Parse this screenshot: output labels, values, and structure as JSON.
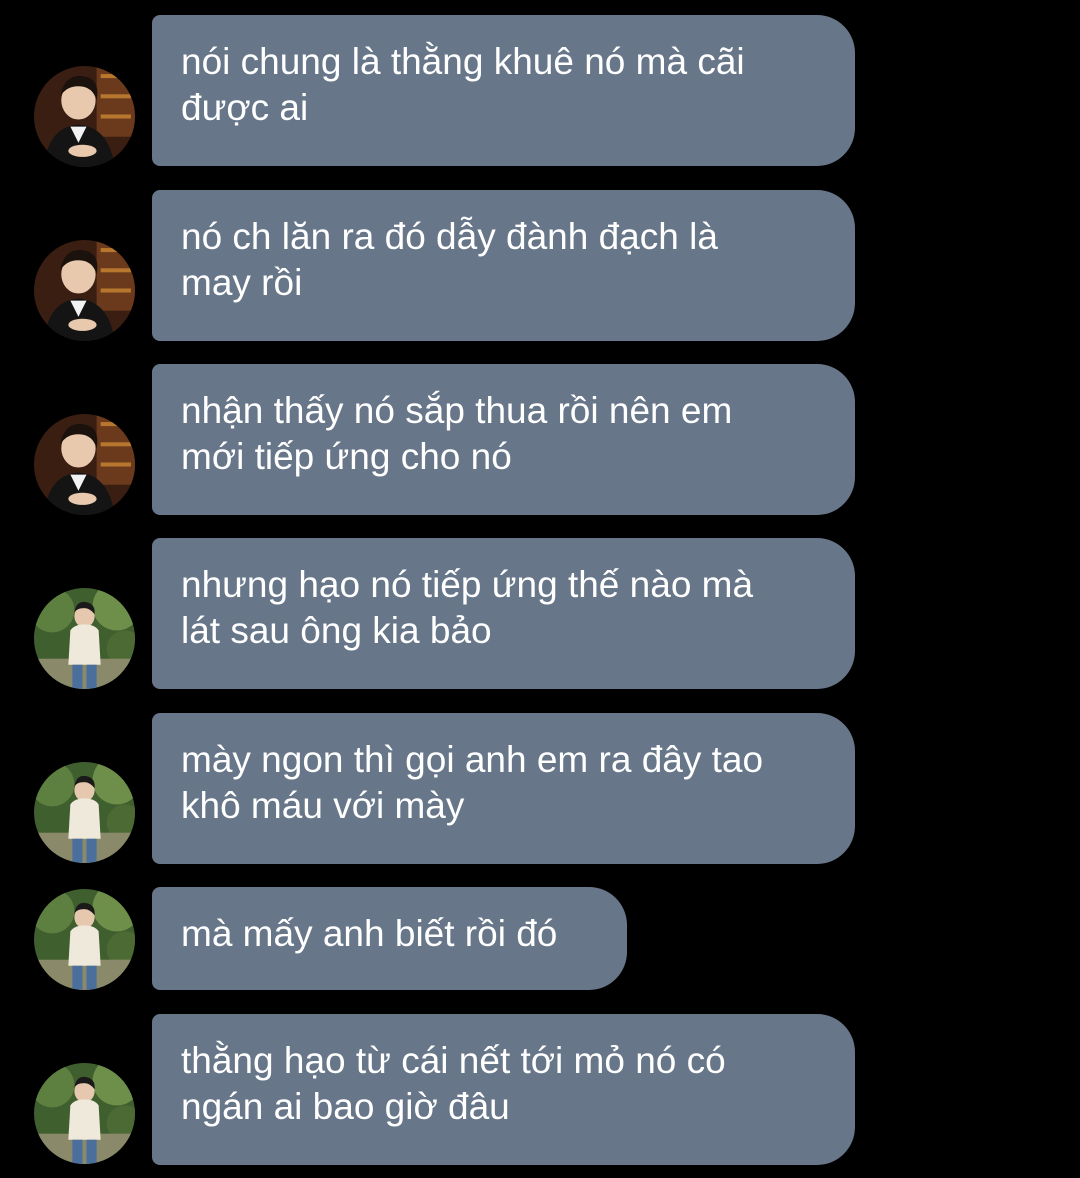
{
  "colors": {
    "background": "#000000",
    "bubble": "#677689",
    "text": "#ffffff"
  },
  "messages": [
    {
      "text": "nói chung là thằng khuê nó mà cãi\nđược ai",
      "avatar": "avatar-a"
    },
    {
      "text": "nó ch lăn ra đó dẫy đành đạch là\nmay rồi",
      "avatar": "avatar-a"
    },
    {
      "text": "nhận thấy nó sắp thua rồi nên em\nmới tiếp ứng cho nó",
      "avatar": "avatar-a"
    },
    {
      "text": "nhưng hạo nó tiếp ứng thế nào mà\nlát sau ông kia bảo",
      "avatar": "avatar-b"
    },
    {
      "text": "mày ngon thì gọi anh em ra đây tao\nkhô máu với mày",
      "avatar": "avatar-b"
    },
    {
      "text": "mà mấy anh biết rồi đó",
      "avatar": "avatar-b"
    },
    {
      "text": "thằng hạo từ cái nết tới mỏ nó có\nngán ai bao giờ đâu",
      "avatar": "avatar-b"
    }
  ]
}
